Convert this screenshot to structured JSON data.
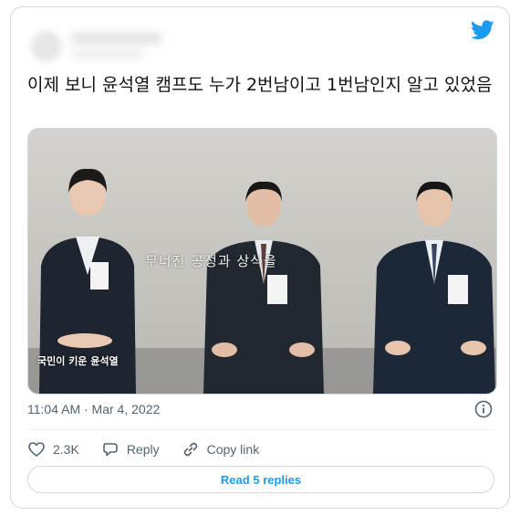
{
  "tweet": {
    "text": "이제 보니 윤석열 캠프도 누가 2번남이고 1번남인지 알고 있었음",
    "media": {
      "subtitle": "무너진 공정과 상식을",
      "caption": "국민이 키운 윤석열"
    },
    "meta": "11:04 AM · Mar 4, 2022",
    "actions": {
      "likes": "2.3K",
      "reply_label": "Reply",
      "copy_link_label": "Copy link"
    },
    "read_replies_label": "Read 5 replies"
  },
  "colors": {
    "accent": "#1d9bf0",
    "secondary_text": "#536471",
    "border": "#cfd9de"
  },
  "icons": [
    "twitter-bird-icon",
    "info-icon",
    "heart-icon",
    "reply-bubble-icon",
    "link-icon"
  ]
}
